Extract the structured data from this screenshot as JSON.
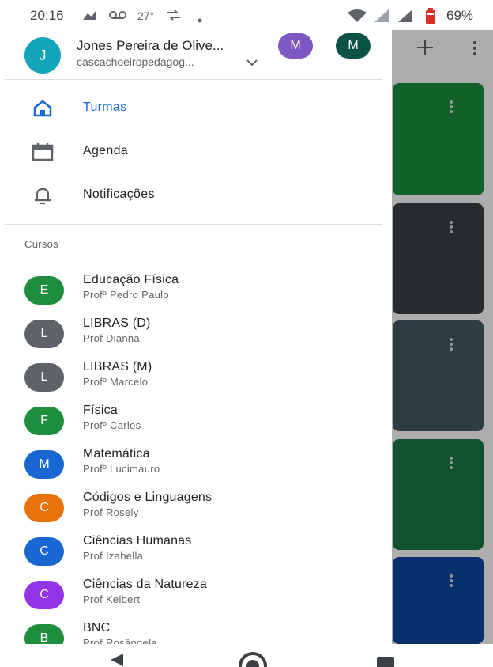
{
  "status_bar": {
    "time": "20:16",
    "temperature": "27°",
    "battery_pct": "69%",
    "icons": [
      "notification-broom-icon",
      "voicemail-icon",
      "temperature-icon",
      "sync-icon",
      "dot-icon",
      "wifi-icon",
      "signal-icon",
      "signal-icon",
      "battery-icon"
    ]
  },
  "account": {
    "avatar_letter": "J",
    "name": "Jones Pereira de Olive...",
    "email": "cascachoeiropedagog...",
    "other_accounts": [
      {
        "letter": "M",
        "color": "#7e57c2"
      },
      {
        "letter": "M",
        "color": "#0b5345"
      }
    ]
  },
  "nav": [
    {
      "label": "Turmas",
      "icon": "home-icon",
      "active": true
    },
    {
      "label": "Agenda",
      "icon": "calendar-icon",
      "active": false
    },
    {
      "label": "Notificações",
      "icon": "bell-icon",
      "active": false
    }
  ],
  "section_label": "Cursos",
  "courses": [
    {
      "letter": "E",
      "title": "Educação Física",
      "teacher": "Profº Pedro Paulo",
      "color": "#1e8e3e"
    },
    {
      "letter": "L",
      "title": "LIBRAS (D)",
      "teacher": "Prof Dianna",
      "color": "#5f6368"
    },
    {
      "letter": "L",
      "title": "LIBRAS (M)",
      "teacher": "Profº Marcelo",
      "color": "#5f6368"
    },
    {
      "letter": "F",
      "title": "Física",
      "teacher": "Profº Carlos",
      "color": "#1e8e3e"
    },
    {
      "letter": "M",
      "title": "Matemática",
      "teacher": "Profº Lucimauro",
      "color": "#1967d2"
    },
    {
      "letter": "C",
      "title": "Códigos e Linguagens",
      "teacher": "Prof Rosely",
      "color": "#e8710a"
    },
    {
      "letter": "C",
      "title": "Ciências Humanas",
      "teacher": "Prof Izabella",
      "color": "#1967d2"
    },
    {
      "letter": "C",
      "title": "Ciências da Natureza",
      "teacher": "Prof Kelbert",
      "color": "#9334e6"
    },
    {
      "letter": "B",
      "title": "BNC",
      "teacher": "Prof Rosângela",
      "color": "#1e8e3e"
    }
  ],
  "colors": {
    "accent": "#1967d2",
    "account_avatar": "#12a4b8"
  }
}
